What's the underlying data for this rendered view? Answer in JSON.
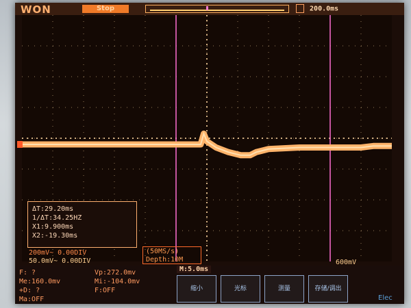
{
  "header": {
    "brand": "WON",
    "run_state": "Stop",
    "timebase": "200.0ms"
  },
  "measurements": {
    "delta_t": "ΔT:29.20ms",
    "inv_delta_t": "1/ΔT:34.25HZ",
    "cursor1": "X1:9.900ms",
    "cursor2": "X2:-19.30ms"
  },
  "channels": {
    "ch1": "200mV~  0.00DIV",
    "ch2": "50.0mV~  0.00DIV"
  },
  "acquisition": {
    "sample_rate": "(50MS/s)",
    "depth": "Depth:10M"
  },
  "trigger_level": "600mV",
  "bottom_readings": {
    "freq": "F:  ?",
    "vp": "Vp:272.0mv",
    "mean": "Me:160.0mv",
    "min": "Mi:-104.0mv",
    "duty": "+D:  ?",
    "filter": "F:OFF",
    "math": "Ma:OFF"
  },
  "horizontal_position": "M:5.0ms",
  "softkeys": [
    "缩小",
    "光标",
    "测量",
    "存储/调出"
  ],
  "watermark": "Elec",
  "colors": {
    "trace": "#ffb36a",
    "cursor": "#ff6fd1",
    "grid": "#ffd7a0"
  },
  "chart_data": {
    "type": "line",
    "title": "",
    "xlabel": "",
    "ylabel": "",
    "divisions": {
      "x": 12,
      "y": 8
    },
    "cursors_div": [
      5.0,
      10.0
    ],
    "trigger_div": 6.2,
    "x": [
      0,
      1,
      2,
      3,
      4,
      5,
      5.8,
      5.9,
      6.0,
      6.3,
      6.7,
      7.1,
      7.4,
      7.6,
      8.0,
      9,
      10,
      11,
      11.4,
      12
    ],
    "y": [
      -0.2,
      -0.2,
      -0.2,
      -0.2,
      -0.2,
      -0.2,
      -0.2,
      0.15,
      -0.1,
      -0.3,
      -0.45,
      -0.55,
      -0.55,
      -0.45,
      -0.35,
      -0.3,
      -0.3,
      -0.3,
      -0.25,
      -0.25
    ]
  }
}
